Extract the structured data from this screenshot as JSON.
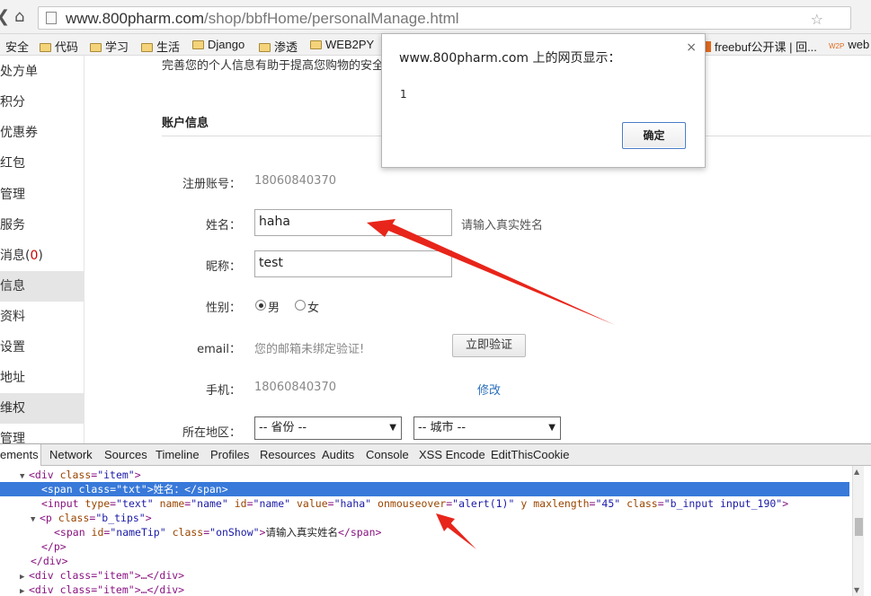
{
  "browser": {
    "url_domain": "www.800pharm.com",
    "url_path": "/shop/bbfHome/personalManage.html",
    "bookmarks": [
      "安全",
      "代码",
      "学习",
      "生活",
      "Django",
      "渗透",
      "WEB2PY",
      "freebuf公开课 | 回...",
      "web"
    ]
  },
  "sidebar": {
    "items": [
      {
        "label": "处方单"
      },
      {
        "label": "积分"
      },
      {
        "label": "优惠券"
      },
      {
        "label": "红包"
      },
      {
        "label": "管理"
      },
      {
        "label": "服务"
      },
      {
        "label": "消息(",
        "count": "0",
        "suffix": ")"
      },
      {
        "label": "信息"
      },
      {
        "label": "资料"
      },
      {
        "label": "设置"
      },
      {
        "label": "地址"
      },
      {
        "label": "维权"
      },
      {
        "label": "管理"
      }
    ]
  },
  "form": {
    "intro": "完善您的个人信息有助于提高您购物的安全",
    "section_title": "账户信息",
    "account_label": "注册账号：",
    "account_value": "18060840370",
    "name_label": "姓名：",
    "name_value": "haha",
    "name_tip": "请输入真实姓名",
    "nick_label": "昵称：",
    "nick_value": "test",
    "gender_label": "性别：",
    "gender_male": "男",
    "gender_female": "女",
    "email_label": "email：",
    "email_value": "您的邮箱未绑定验证!",
    "verify_button": "立即验证",
    "phone_label": "手机：",
    "phone_value": "18060840370",
    "modify_link": "修改",
    "region_label": "所在地区：",
    "province_select": "-- 省份 --",
    "city_select": "-- 城市 --"
  },
  "dialog": {
    "title": "www.800pharm.com 上的网页显示：",
    "message": "1",
    "ok_button": "确定",
    "close_symbol": "×"
  },
  "devtools": {
    "tabs": [
      "ements",
      "Network",
      "Sources",
      "Timeline",
      "Profiles",
      "Resources",
      "Audits",
      "Console",
      "XSS Encode",
      "EditThisCookie"
    ],
    "lines": [
      {
        "tri": "▼",
        "indent": "",
        "tag_open": "<div ",
        "a1": "class",
        "v1": "\"item\"",
        "tag_close": ">"
      },
      {
        "tri": "",
        "indent": "  ",
        "tag_open": "<span ",
        "a1": "class",
        "v1": "\"txt\"",
        "tag_close": ">",
        "text": "姓名：",
        "end": "</span>"
      },
      {
        "tri": "",
        "indent": "  ",
        "raw": "<input type=\"text\" name=\"name\" id=\"name\" value=\"haha\" onmouseover=\"alert(1)\" y maxlength=\"45\" class=\"b_input input_190\">"
      },
      {
        "tri": "▼",
        "indent": "  ",
        "tag_open": "<p ",
        "a1": "class",
        "v1": "\"b_tips\"",
        "tag_close": ">"
      },
      {
        "tri": "",
        "indent": "    ",
        "tag_open": "<span ",
        "a1": "id",
        "v1": "\"nameTip\"",
        "a2": "class",
        "v2": "\"onShow\"",
        "tag_close": ">",
        "text": "请输入真实姓名",
        "end": "</span>"
      },
      {
        "tri": "",
        "indent": "  ",
        "end_only": "</p>"
      },
      {
        "tri": "",
        "indent": "",
        "end_only": "</div>"
      },
      {
        "tri": "▶",
        "indent": "",
        "collapsed": "<div class=\"item\">…</div>"
      },
      {
        "tri": "▶",
        "indent": "",
        "collapsed": "<div class=\"item\">…</div>"
      }
    ]
  }
}
